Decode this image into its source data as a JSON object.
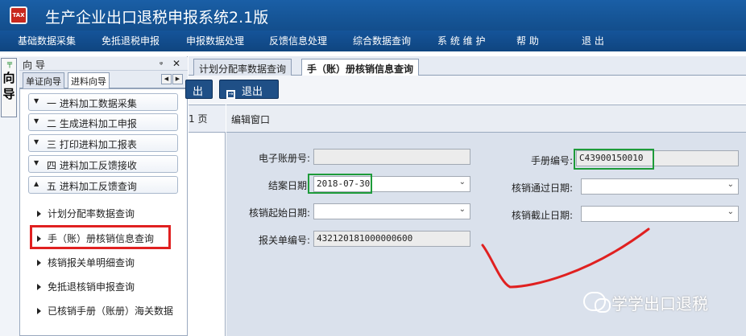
{
  "app": {
    "title": "生产企业出口退税申报系统2.1版",
    "icon_label": "tax"
  },
  "menu": [
    "基础数据采集",
    "免抵退税申报",
    "申报数据处理",
    "反馈信息处理",
    "综合数据查询",
    "系 统 维 护",
    "帮  助",
    "退  出"
  ],
  "vertical_tab": {
    "label_top": "向",
    "label_bottom": "导"
  },
  "nav": {
    "header": "向 导",
    "pin": "ᵩ",
    "close": "✕",
    "tabs": [
      "单证向导",
      "进料向导"
    ],
    "sections": [
      {
        "label": "一  进料加工数据采集"
      },
      {
        "label": "二  生成进料加工申报"
      },
      {
        "label": "三  打印进料加工报表"
      },
      {
        "label": "四  进料加工反馈接收"
      },
      {
        "label": "五  进料加工反馈查询"
      }
    ],
    "sub_items": [
      "计划分配率数据查询",
      "手（账）册核销信息查询",
      "核销报关单明细查询",
      "免抵退核销申报查询",
      "已核销手册（账册）海关数据"
    ]
  },
  "doc_tabs": [
    "计划分配率数据查询",
    "手（账）册核销信息查询"
  ],
  "toolbar": {
    "left_partial": "出",
    "exit": "退出"
  },
  "list": {
    "header": "1 页"
  },
  "edit": {
    "title": "编辑窗口",
    "labels": {
      "ebook_no": "电子账册号:",
      "close_date": "结案日期:",
      "verify_start": "核销起始日期:",
      "customs_no": "报关单编号:",
      "manual_no": "手册编号:",
      "verify_pass_date": "核销通过日期:",
      "verify_end": "核销截止日期:"
    },
    "values": {
      "ebook_no": "",
      "close_date": "2018-07-30",
      "verify_start": "",
      "customs_no": "432120181000000600",
      "manual_no": "C43900150010",
      "verify_pass_date": "",
      "verify_end": ""
    }
  },
  "watermark": "学学出口退税",
  "colors": {
    "title_bg": "#1a5fa6",
    "button_bg": "#1f4f86",
    "highlight_red": "#e02020",
    "highlight_green": "#1e9b3a"
  }
}
